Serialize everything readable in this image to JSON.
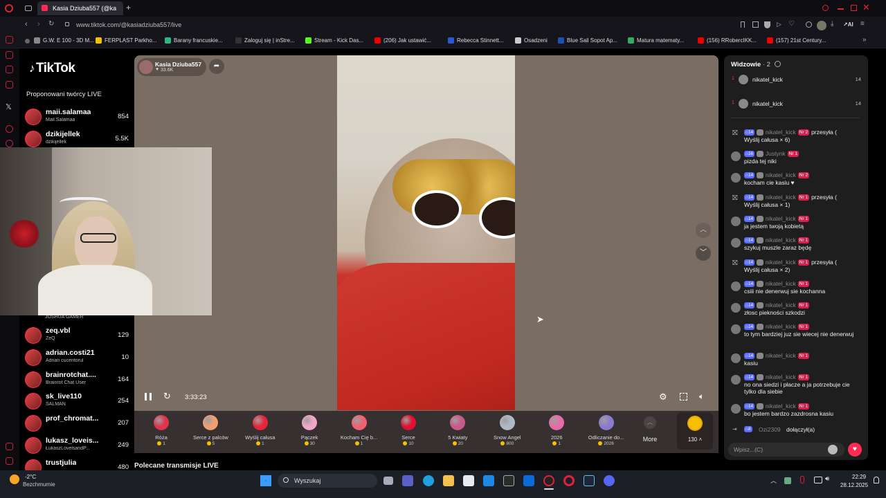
{
  "browser": {
    "tab_title": "Kasia Dziuba557 (@ka",
    "url": "www.tiktok.com/@kasiadziuba557/live",
    "bookmarks": [
      {
        "label": "G.W. E 100 - 3D M...",
        "color": "#888"
      },
      {
        "label": "FERPLAST Parkho...",
        "color": "#f2c200"
      },
      {
        "label": "Barany francuskie...",
        "color": "#2fb57e"
      },
      {
        "label": "Zaloguj się | inStre...",
        "color": "#333"
      },
      {
        "label": "Stream - Kick Das...",
        "color": "#53fc18"
      },
      {
        "label": "(206) Jak ustawić...",
        "color": "#e00"
      },
      {
        "label": "Rebecca Stinnett...",
        "color": "#2b57d0"
      },
      {
        "label": "Osadzeni",
        "color": "#ccc"
      },
      {
        "label": "Blue Sail Sopot Ap...",
        "color": "#1f4fb3"
      },
      {
        "label": "Matura matematy...",
        "color": "#3a6"
      },
      {
        "label": "(156) RRobercIKK...",
        "color": "#e00"
      },
      {
        "label": "(157) 21st Century...",
        "color": "#e00"
      }
    ]
  },
  "left": {
    "logo": "TikTok",
    "rec_title": "Proponowani twórcy LIVE",
    "creators_top": [
      {
        "name": "maii.salamaa",
        "sub": "Mail.Salamaa",
        "viewers": "854"
      },
      {
        "name": "dzikijellek",
        "sub": "dzikijellek",
        "viewers": "5.5K"
      }
    ],
    "partial_sub": "JOSHUA GAMER",
    "creators_bottom": [
      {
        "name": "zeq.vbl",
        "sub": "ZeQ",
        "viewers": "129"
      },
      {
        "name": "adrian.costi21",
        "sub": "Adrian cuceritorul",
        "viewers": "10"
      },
      {
        "name": "brainrotchat....",
        "sub": "Brainrot Chat User",
        "viewers": "164"
      },
      {
        "name": "sk_live110",
        "sub": "SALMAN",
        "viewers": "254"
      },
      {
        "name": "prof_chromat...",
        "sub": "",
        "viewers": "207"
      },
      {
        "name": "lukasz_loveis...",
        "sub": "ŁukaszLovelsandP...",
        "viewers": "249"
      },
      {
        "name": "trustjulia",
        "sub": "",
        "viewers": "480"
      }
    ]
  },
  "player": {
    "host_name": "Kasia Dziuba557",
    "host_likes": "33.6K",
    "timecode": "3:33:23",
    "gifts": [
      {
        "name": "Róża",
        "price": "1",
        "color": "#e0334d"
      },
      {
        "name": "Serce z palców",
        "price": "5",
        "color": "#f0a070"
      },
      {
        "name": "Wyślij całusa",
        "price": "1",
        "color": "#e8243a"
      },
      {
        "name": "Pączek",
        "price": "30",
        "color": "#f3a6c8"
      },
      {
        "name": "Kocham Cię b...",
        "price": "1",
        "color": "#f06070"
      },
      {
        "name": "Serce",
        "price": "10",
        "color": "#e01030"
      },
      {
        "name": "5 Kwiaty",
        "price": "20",
        "color": "#c85a8a"
      },
      {
        "name": "Snow Angel",
        "price": "800",
        "color": "#b0b8c8"
      },
      {
        "name": "2026",
        "price": "1",
        "color": "#e86aa8"
      },
      {
        "name": "Odliczanie do...",
        "price": "2026",
        "color": "#8a7ad0"
      }
    ],
    "more_label": "More",
    "coins_label": "130",
    "below_title": "Polecane transmisje LIVE"
  },
  "chat": {
    "viewers_title": "Widzowie",
    "viewers_count": "2",
    "viewers": [
      {
        "rank": "1",
        "name": "nikatel_kick",
        "score": "14"
      },
      {
        "rank": "1",
        "name": "nikatel_kick",
        "score": "14"
      }
    ],
    "messages": [
      {
        "lvl": "14",
        "user": "nikatel_kick",
        "nr": "Nr 2",
        "tail": "przesyła (",
        "text": "Wyślij całusa × 6)",
        "gift": true
      },
      {
        "lvl": "16",
        "user": "Justynk",
        "nr": "Nr 1",
        "tail": "",
        "text": "pizda tej niki",
        "gift": false
      },
      {
        "lvl": "14",
        "user": "nikatel_kick",
        "nr": "Nr 2",
        "tail": "",
        "text": "kocham cie kasiu ♥",
        "gift": false
      },
      {
        "lvl": "14",
        "user": "nikatel_kick",
        "nr": "Nr 1",
        "tail": "przesyła (",
        "text": "Wyślij całusa × 1)",
        "gift": true
      },
      {
        "lvl": "14",
        "user": "nikatel_kick",
        "nr": "Nr 1",
        "tail": "",
        "text": "ja jestem twoją kobietą",
        "gift": false
      },
      {
        "lvl": "14",
        "user": "nikatel_kick",
        "nr": "Nr 1",
        "tail": "",
        "text": "szykuj muszle zaraz będę",
        "gift": false
      },
      {
        "lvl": "14",
        "user": "nikatel_kick",
        "nr": "Nr 1",
        "tail": "przesyła (",
        "text": "Wyślij całusa × 2)",
        "gift": true
      },
      {
        "lvl": "14",
        "user": "nikatel_kick",
        "nr": "Nr 1",
        "tail": "",
        "text": "csiii nie denerwuj sie kochanna",
        "gift": false
      },
      {
        "lvl": "14",
        "user": "nikatel_kick",
        "nr": "Nr 1",
        "tail": "",
        "text": "złosc piekności szkodzi",
        "gift": false
      },
      {
        "lvl": "14",
        "user": "nikatel_kick",
        "nr": "Nr 1",
        "tail": "",
        "text": "to tym bardziej juz sie wiecej nie denerwuj",
        "gift": false
      },
      {
        "lvl": "14",
        "user": "nikatel_kick",
        "nr": "Nr 1",
        "tail": "",
        "text": "kasiu",
        "gift": false
      },
      {
        "lvl": "14",
        "user": "nikatel_kick",
        "nr": "Nr 1",
        "tail": "",
        "text": "no ona siedzi i płacze a ja potrzebuje cie tylko dla siebie",
        "gift": false
      },
      {
        "lvl": "14",
        "user": "nikatel_kick",
        "nr": "Nr 1",
        "tail": "",
        "text": "bo jestem bardzo zazdrosna kasiu",
        "gift": false
      }
    ],
    "join_level": "8",
    "join_user": "Ozi2309",
    "join_text": "dołączył(a)",
    "input_placeholder": "Wpisz...(C)"
  },
  "taskbar": {
    "weather_temp": "-2°C",
    "weather_desc": "Bezchmurnie",
    "search_label": "Wyszukaj",
    "time": "22:29",
    "date": "28.12.2025"
  }
}
